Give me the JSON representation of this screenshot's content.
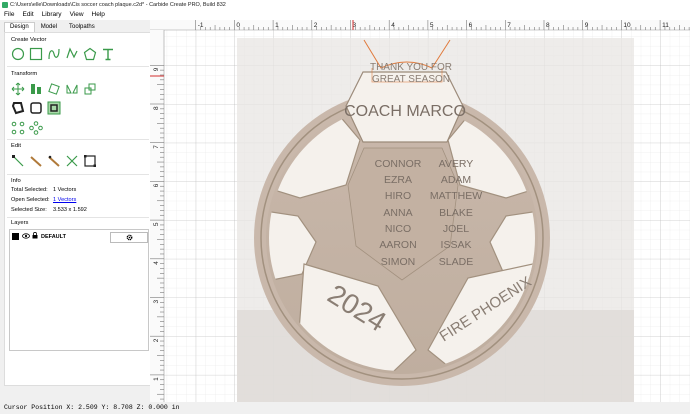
{
  "window": {
    "title": "C:\\Users\\elle\\Downloads\\Cis soccer coach plaque.c2d* - Carbide Create PRO, Build 832"
  },
  "menu": [
    "File",
    "Edit",
    "Library",
    "View",
    "Help"
  ],
  "tabs": [
    "Design",
    "Model",
    "Toolpaths"
  ],
  "panel": {
    "create_vector": "Create Vector",
    "transform": "Transform",
    "edit": "Edit",
    "info": "Info",
    "layers": "Layers"
  },
  "info": {
    "total_selected_label": "Total Selected:",
    "total_selected_value": "1 Vectors",
    "open_selected_label": "Open Selected:",
    "open_selected_value": "1 Vectors",
    "selected_size_label": "Selected Size:",
    "selected_size_value": "3.533 x 1.592"
  },
  "layers": [
    {
      "name": "DEFAULT",
      "color": "#000000"
    }
  ],
  "ruler": {
    "h_labels": [
      "-1",
      "0",
      "1",
      "2",
      "3",
      "4",
      "5",
      "6",
      "7",
      "8",
      "9",
      "10",
      "11"
    ],
    "v_labels": [
      "9",
      "8",
      "7",
      "6",
      "5",
      "4",
      "3",
      "2",
      "1"
    ]
  },
  "design": {
    "top_banner": [
      "THANK YOU FOR",
      "GREAT SEASON"
    ],
    "coach": "COACH MARCO",
    "names_left": [
      "CONNOR",
      "EZRA",
      "HIRO",
      "ANNA",
      "NICO",
      "AARON",
      "SIMON"
    ],
    "names_right": [
      "AVERY",
      "ADAM",
      "MATTHEW",
      "BLAKE",
      "JOEL",
      "ISSAK",
      "SLADE"
    ],
    "year": "2024",
    "team": "FIRE PHOENIX"
  },
  "status": "Cursor Position X: 2.509 Y: 8.708 Z: 0.000 in",
  "colors": {
    "wood": "#c9b8ab",
    "plate": "#f4efe9",
    "accent": "#e07a3c",
    "ruler_mark": "#d32f2f"
  }
}
